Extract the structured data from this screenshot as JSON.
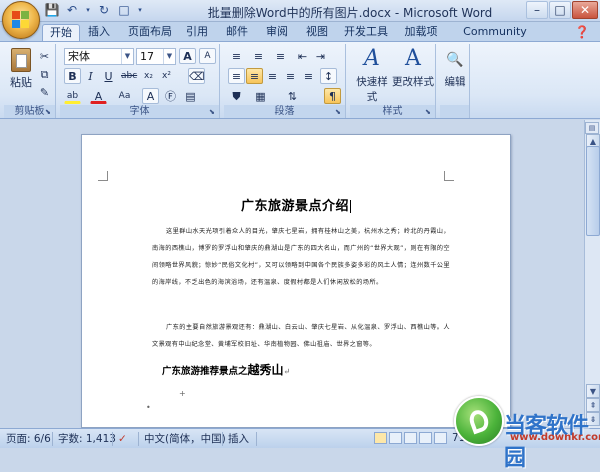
{
  "window": {
    "title": "批量删除Word中的所有图片.docx - Microsoft Word",
    "minimize": "–",
    "maximize": "□",
    "close": "✕"
  },
  "quick_access": [
    "save-icon",
    "undo-icon",
    "redo-icon",
    "customize-icon"
  ],
  "tabs": [
    {
      "label": "开始",
      "active": true
    },
    {
      "label": "插入"
    },
    {
      "label": "页面布局"
    },
    {
      "label": "引用"
    },
    {
      "label": "邮件"
    },
    {
      "label": "审阅"
    },
    {
      "label": "视图"
    },
    {
      "label": "开发工具"
    },
    {
      "label": "加载项"
    },
    {
      "label": "Community Clips"
    }
  ],
  "ribbon": {
    "clipboard": {
      "label": "剪贴板",
      "paste": "粘贴"
    },
    "font": {
      "label": "字体",
      "font_name": "宋体",
      "font_size": "17",
      "grow": "A",
      "shrink": "A"
    },
    "paragraph": {
      "label": "段落"
    },
    "styles": {
      "label": "样式",
      "quick_styles": "快速样式",
      "change_styles": "更改样式"
    },
    "editing": {
      "label": "编辑",
      "edit": "编辑"
    }
  },
  "document": {
    "title": "广东旅游景点介绍",
    "paragraph1": "这里群山水天光项引着众人的目光，肇庆七星岩，拥有桂林山之美，杭州水之秀；岭北的丹霞山，南海的西樵山，博罗的罗浮山和肇庆的鼎湖山是广东的四大名山，而广州的“世界大观”，则在有限的空间领略世界风貌；惊妙“民俗文化村”，又可以领略到中国各个民族多姿多彩的风土人情；连州数千公里的海岸线，不乏出色的海滨浴场，还有温泉、度假村都是人们休闲放松的场所。",
    "paragraph2": "广东的主要自然旅游景观还有：鼎湖山、白云山、肇庆七星岩、从化温泉、罗浮山、西樵山等。人文景观有中山纪念堂、黄埔军校旧址、华南植物园、佛山祖庙、世界之窗等。",
    "subheading_prefix": "广东旅游推荐景点之",
    "subheading_emph": "越秀山"
  },
  "statusbar": {
    "page": "页面: 6/6",
    "words": "字数: 1,413",
    "language": "中文(简体，中国)",
    "mode": "插入",
    "zoom": "71%"
  },
  "watermark": {
    "text": "当客软件园",
    "url": "www.downkr.com"
  }
}
